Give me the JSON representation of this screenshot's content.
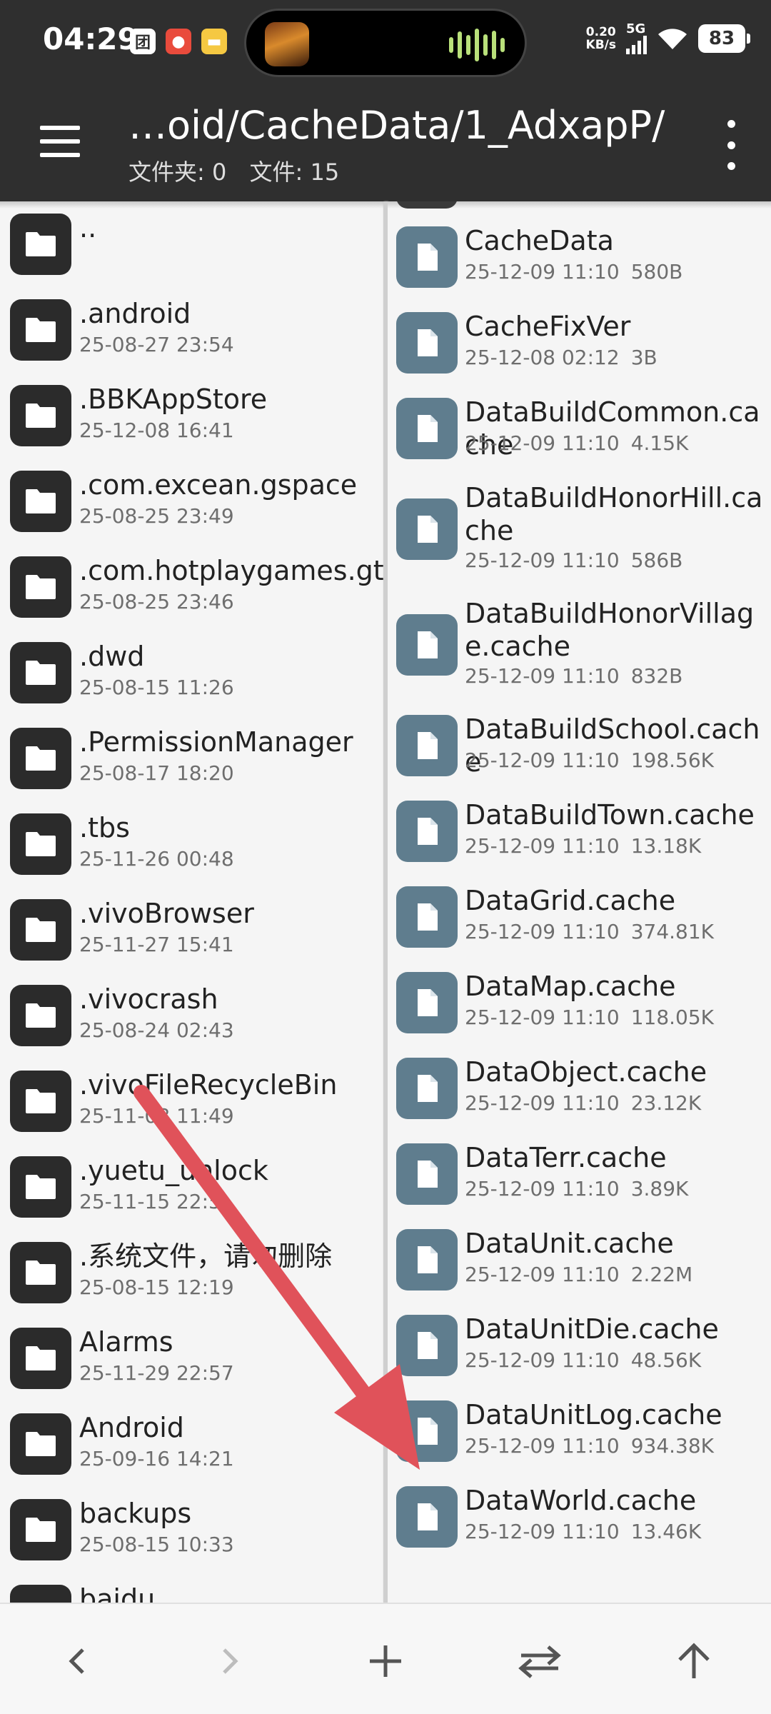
{
  "status_bar": {
    "time": "04:29",
    "net_speed_value": "0.20",
    "net_speed_unit": "KB/s",
    "network_type": "5G",
    "battery": "83",
    "notification_icon_names": [
      "meituan-icon",
      "app-icon",
      "notes-icon"
    ]
  },
  "toolbar": {
    "path": "…oid/CacheData/1_AdxapP/",
    "folders_label": "文件夹: 0",
    "files_label": "文件: 15"
  },
  "left_pane": {
    "items": [
      {
        "name": "..",
        "meta": ""
      },
      {
        "name": ".android",
        "meta": "25-08-27 23:54"
      },
      {
        "name": ".BBKAppStore",
        "meta": "25-12-08 16:41"
      },
      {
        "name": ".com.excean.gspace",
        "meta": "25-08-25 23:49"
      },
      {
        "name": ".com.hotplaygames.gt",
        "meta": "25-08-25 23:46"
      },
      {
        "name": ".dwd",
        "meta": "25-08-15 11:26"
      },
      {
        "name": ".PermissionManager",
        "meta": "25-08-17 18:20"
      },
      {
        "name": ".tbs",
        "meta": "25-11-26 00:48"
      },
      {
        "name": ".vivoBrowser",
        "meta": "25-11-27 15:41"
      },
      {
        "name": ".vivocrash",
        "meta": "25-08-24 02:43"
      },
      {
        "name": ".vivoFileRecycleBin",
        "meta": "25-11-08 11:49"
      },
      {
        "name": ".yuetu_unlock",
        "meta": "25-11-15 22:5"
      },
      {
        "name": ".系统文件，请勿删除",
        "meta": "25-08-15 12:19"
      },
      {
        "name": "Alarms",
        "meta": "25-11-29 22:57"
      },
      {
        "name": "Android",
        "meta": "25-09-16 14:21"
      },
      {
        "name": "backups",
        "meta": "25-08-15 10:33"
      },
      {
        "name": "baidu",
        "meta": ""
      }
    ]
  },
  "right_pane": {
    "items": [
      {
        "name": "CacheData",
        "date": "25-12-09 11:10",
        "size": "580B"
      },
      {
        "name": "CacheFixVer",
        "date": "25-12-08 02:12",
        "size": "3B"
      },
      {
        "name": "DataBuildCommon.cache",
        "date": "25-12-09 11:10",
        "size": "4.15K"
      },
      {
        "name": "DataBuildHonorHill.cache",
        "date": "25-12-09 11:10",
        "size": "586B"
      },
      {
        "name": "DataBuildHonorVillage.cache",
        "date": "25-12-09 11:10",
        "size": "832B"
      },
      {
        "name": "DataBuildSchool.cache",
        "date": "25-12-09 11:10",
        "size": "198.56K"
      },
      {
        "name": "DataBuildTown.cache",
        "date": "25-12-09 11:10",
        "size": "13.18K"
      },
      {
        "name": "DataGrid.cache",
        "date": "25-12-09 11:10",
        "size": "374.81K"
      },
      {
        "name": "DataMap.cache",
        "date": "25-12-09 11:10",
        "size": "118.05K"
      },
      {
        "name": "DataObject.cache",
        "date": "25-12-09 11:10",
        "size": "23.12K"
      },
      {
        "name": "DataTerr.cache",
        "date": "25-12-09 11:10",
        "size": "3.89K"
      },
      {
        "name": "DataUnit.cache",
        "date": "25-12-09 11:10",
        "size": "2.22M"
      },
      {
        "name": "DataUnitDie.cache",
        "date": "25-12-09 11:10",
        "size": "48.56K"
      },
      {
        "name": "DataUnitLog.cache",
        "date": "25-12-09 11:10",
        "size": "934.38K"
      },
      {
        "name": "DataWorld.cache",
        "date": "25-12-09 11:10",
        "size": "13.46K"
      }
    ]
  },
  "bottom_bar": {
    "buttons": [
      "back-icon",
      "forward-icon",
      "add-icon",
      "swap-icon",
      "up-icon"
    ]
  },
  "annotation": {
    "arrow_color": "#e0525a",
    "points_to": "DataUnitLog.cache"
  }
}
